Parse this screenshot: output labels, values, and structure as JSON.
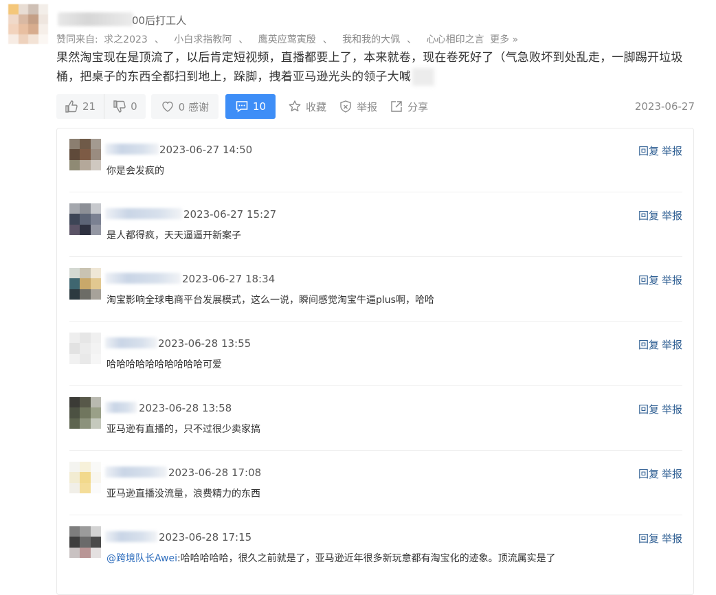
{
  "post": {
    "author_suffix": "00后打工人",
    "likes_prefix": "赞同来自:",
    "likers": [
      "求之2023",
      "小白求指教阿",
      "鹰英应莺寅殷",
      "我和我的大佩",
      "心心相印之言"
    ],
    "likes_more": "更多 »",
    "content": "果然淘宝现在是顶流了，以后肯定短视频，直播都要上了，本来就卷，现在卷死好了（气急败坏到处乱走，一脚踢开垃圾桶，把桌子的东西全都扫到地上，跺脚，拽着亚马逊光头的领子大喊",
    "upvote_count": "21",
    "downvote_count": "0",
    "thanks_label": "0 感谢",
    "comment_count": "10",
    "favorite_label": "收藏",
    "report_label": "举报",
    "share_label": "分享",
    "date": "2023-06-27"
  },
  "comments": [
    {
      "time": "2023-06-27 14:50",
      "text": "你是会发疯的",
      "mention": "",
      "reply": "回复",
      "report": "举报"
    },
    {
      "time": "2023-06-27 15:27",
      "text": "是人都得疯，天天逼逼开新案子",
      "mention": "",
      "reply": "回复",
      "report": "举报"
    },
    {
      "time": "2023-06-27 18:34",
      "text": "淘宝影响全球电商平台发展模式，这么一说，瞬间感觉淘宝牛逼plus啊，哈哈",
      "mention": "",
      "reply": "回复",
      "report": "举报"
    },
    {
      "time": "2023-06-28 13:55",
      "text": "哈哈哈哈哈哈哈哈哈哈可爱",
      "mention": "",
      "reply": "回复",
      "report": "举报"
    },
    {
      "time": "2023-06-28 13:58",
      "text": "亚马逊有直播的，只不过很少卖家搞",
      "mention": "",
      "reply": "回复",
      "report": "举报"
    },
    {
      "time": "2023-06-28 17:08",
      "text": "亚马逊直播没流量，浪费精力的东西",
      "mention": "",
      "reply": "回复",
      "report": "举报"
    },
    {
      "time": "2023-06-28 17:15",
      "text": ":哈哈哈哈哈，很久之前就是了，亚马逊近年很多新玩意都有淘宝化的迹象。顶流属实是了",
      "mention": "@跨境队长Awei",
      "reply": "回复",
      "report": "举报"
    }
  ],
  "colors": {
    "accent": "#3e8ef7",
    "link": "#2f5f93",
    "mention": "#2f6ebd"
  }
}
